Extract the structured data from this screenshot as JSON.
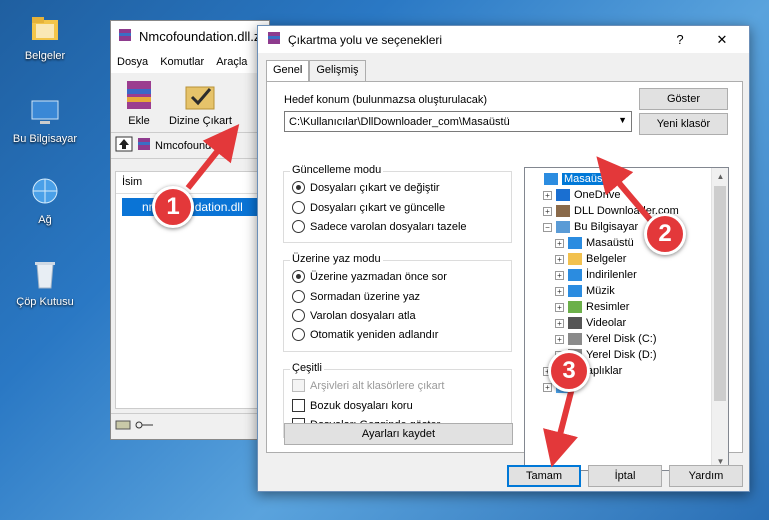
{
  "desktop": {
    "icons": [
      {
        "label": "Belgeler",
        "icon": "folder-icon"
      },
      {
        "label": "Bu Bilgisayar",
        "icon": "computer-icon"
      },
      {
        "label": "Ağ",
        "icon": "network-icon"
      },
      {
        "label": "Çöp Kutusu",
        "icon": "recycle-bin-icon"
      }
    ]
  },
  "rar_window": {
    "title": "Nmcofoundation.dll.z",
    "menu": [
      "Dosya",
      "Komutlar",
      "Araçla"
    ],
    "tools": [
      {
        "label": "Ekle",
        "icon": "add-archive-icon"
      },
      {
        "label": "Dizine Çıkart",
        "icon": "extract-to-icon"
      }
    ],
    "path_text": "Nmcofound",
    "column_header": "İsim",
    "file_name": "nmcofoundation.dll"
  },
  "dialog": {
    "title": "Çıkartma yolu ve seçenekleri",
    "help_button": "?",
    "close_button": "✕",
    "tabs": [
      "Genel",
      "Gelişmiş"
    ],
    "destination_label": "Hedef konum (bulunmazsa oluşturulacak)",
    "destination_value": "C:\\Kullanıcılar\\DllDownloader_com\\Masaüstü",
    "show_button": "Göster",
    "new_folder_button": "Yeni klasör",
    "update_mode": {
      "label": "Güncelleme modu",
      "options": [
        "Dosyaları çıkart ve değiştir",
        "Dosyaları çıkart ve güncelle",
        "Sadece varolan dosyaları tazele"
      ],
      "selected": 0
    },
    "overwrite_mode": {
      "label": "Üzerine yaz modu",
      "options": [
        "Üzerine yazmadan önce sor",
        "Sormadan üzerine yaz",
        "Varolan dosyaları atla",
        "Otomatik yeniden adlandır"
      ],
      "selected": 0
    },
    "misc": {
      "label": "Çeşitli",
      "options": [
        {
          "text": "Arşivleri alt klasörlere çıkart",
          "disabled": true,
          "checked": false
        },
        {
          "text": "Bozuk dosyaları koru",
          "disabled": false,
          "checked": false
        },
        {
          "text": "Dosyaları Gezginde göster",
          "disabled": false,
          "checked": false
        }
      ]
    },
    "save_settings_button": "Ayarları kaydet",
    "tree": [
      {
        "label": "Masaüstü",
        "level": 0,
        "icon": "desktop-icon",
        "selected": true,
        "expander": ""
      },
      {
        "label": "OneDrive",
        "level": 1,
        "icon": "onedrive-icon",
        "selected": false,
        "expander": "+"
      },
      {
        "label": "DLL Downloader.com",
        "level": 1,
        "icon": "user-icon",
        "selected": false,
        "expander": "+"
      },
      {
        "label": "Bu Bilgisayar",
        "level": 1,
        "icon": "computer-icon",
        "selected": false,
        "expander": "−"
      },
      {
        "label": "Masaüstü",
        "level": 2,
        "icon": "desktop-icon",
        "selected": false,
        "expander": "+"
      },
      {
        "label": "Belgeler",
        "level": 2,
        "icon": "documents-icon",
        "selected": false,
        "expander": "+"
      },
      {
        "label": "İndirilenler",
        "level": 2,
        "icon": "downloads-icon",
        "selected": false,
        "expander": "+"
      },
      {
        "label": "Müzik",
        "level": 2,
        "icon": "music-icon",
        "selected": false,
        "expander": "+"
      },
      {
        "label": "Resimler",
        "level": 2,
        "icon": "pictures-icon",
        "selected": false,
        "expander": "+"
      },
      {
        "label": "Videolar",
        "level": 2,
        "icon": "videos-icon",
        "selected": false,
        "expander": "+"
      },
      {
        "label": "Yerel Disk (C:)",
        "level": 2,
        "icon": "drive-icon",
        "selected": false,
        "expander": "+"
      },
      {
        "label": "Yerel Disk (D:)",
        "level": 2,
        "icon": "drive-icon",
        "selected": false,
        "expander": "+"
      },
      {
        "label": "Kitaplıklar",
        "level": 1,
        "icon": "libraries-icon",
        "selected": false,
        "expander": "+"
      },
      {
        "label": "",
        "level": 1,
        "icon": "network-icon",
        "selected": false,
        "expander": "+"
      }
    ],
    "ok_button": "Tamam",
    "cancel_button": "İptal",
    "help_text_button": "Yardım"
  },
  "annotations": [
    {
      "number": "1",
      "color": "#e3383a"
    },
    {
      "number": "2",
      "color": "#e3383a"
    },
    {
      "number": "3",
      "color": "#e3383a"
    }
  ]
}
